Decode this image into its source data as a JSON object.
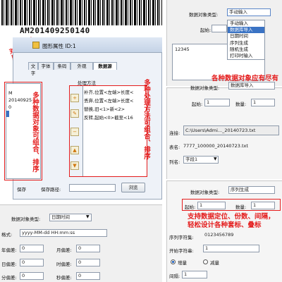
{
  "barcode": {
    "text": "AM201409250140"
  },
  "dialog": {
    "title": "图形属性 ID:1",
    "tabs": [
      "文字",
      "字体",
      "条码",
      "外观",
      "数据源"
    ]
  },
  "left": {
    "data_list": [
      "M",
      "20140925",
      "0"
    ],
    "ops_header": "处理方法",
    "ops": [
      "补齐,位置<左端>长度<",
      "丢弃,位置<左端>长度<",
      "替换,旧<1>新<2>",
      "反转,起始<0>截至<16"
    ],
    "save_label": "保存",
    "save_path_label": "保存路径:",
    "browse_label": "浏览",
    "annot_target": "对应数据",
    "annot_sources": "多种数据对象可组合、排序",
    "annot_methods": "多种处理方法可组合、排序"
  },
  "bottom_left": {
    "type_label": "数据对象类型:",
    "type_value": "日期时间",
    "format_label": "格式:",
    "format_value": "yyyy-MM-dd HH:mm:ss",
    "rows": [
      {
        "a_label": "年偏差:",
        "a_val": "0",
        "b_label": "月偏差:",
        "b_val": "0"
      },
      {
        "a_label": "日偏差:",
        "a_val": "0",
        "b_label": "时偏差:",
        "b_val": "0"
      },
      {
        "a_label": "分偏差:",
        "a_val": "0",
        "b_label": "秒偏差:",
        "b_val": "0"
      }
    ]
  },
  "right_top": {
    "type_label": "数据对象类型:",
    "type_value": "手动输入",
    "start_label": "起始:",
    "text_value": "12345",
    "options": [
      "手动输入",
      "数据库导入",
      "日期时间",
      "序列生成",
      "随机生成",
      "打印时输入"
    ],
    "annot": "各种数据对象应有尽有"
  },
  "right_mid": {
    "type_label": "数据对象类型:",
    "type_value": "数据库导入",
    "start_label": "起始:",
    "start_value": "1",
    "count_label": "数量:",
    "count_value": "1",
    "conn_label": "连接:",
    "conn_value": "C:\\Users\\Admi..._20140723.txt",
    "table_label": "表名:",
    "table_value": "7777_100000_20140723.txt",
    "column_label": "列名:",
    "column_value": "字段1"
  },
  "right_bottom": {
    "type_label": "数据对象类型:",
    "type_value": "序列生成",
    "start_label": "起始:",
    "start_value": "1",
    "count_label": "数量:",
    "count_value": "1",
    "annot": "支持数据定位、份数、间隔，轻松设计各种套标、叠标",
    "seq_label": "序列字符集:",
    "seq_value": "0123456789",
    "startchar_label": "开始字符串:",
    "startchar_value": "1",
    "inc_label": "增量",
    "dec_label": "减量",
    "interval_label": "间隔:",
    "interval_value": "1"
  },
  "colors": {
    "red": "#e41c1c",
    "selection": "#3a73c4"
  }
}
